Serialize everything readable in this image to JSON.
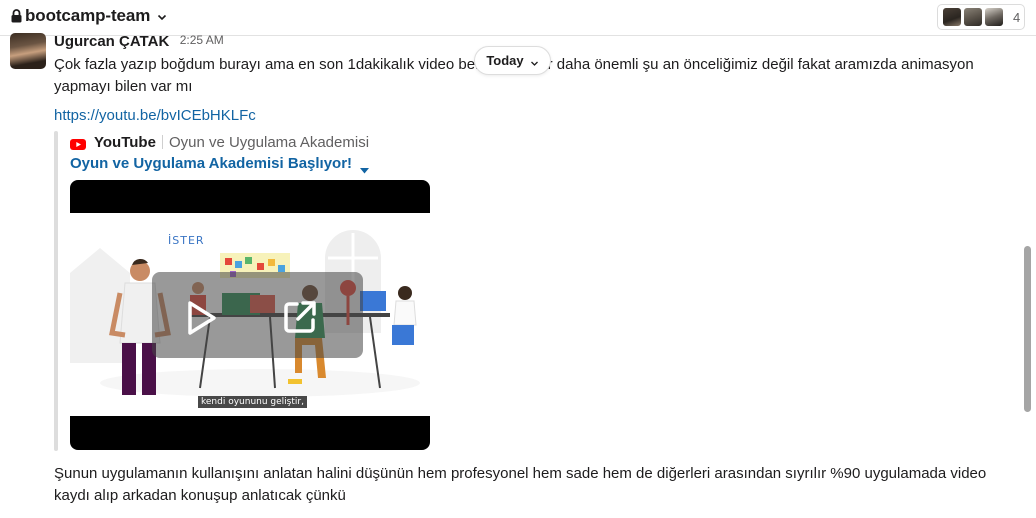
{
  "header": {
    "channel_name": "bootcamp-team",
    "member_count": "4"
  },
  "message": {
    "sender": "Ugurcan ÇATAK",
    "timestamp": "2:25 AM",
    "text": "Çok fazla yazıp boğdum burayı ama en son 1dakikalık video bendeki kadar daha önemli şu an önceliğimiz değil fakat aramızda animasyon yapmayı bilen var mı",
    "link": "https://youtu.be/bvICEbHKLFc"
  },
  "date_divider": {
    "label": "Today"
  },
  "attachment": {
    "provider": "YouTube",
    "channel": "Oyun ve Uygulama Akademisi",
    "title": "Oyun ve Uygulama Akademisi Başlıyor!",
    "thumbnail_sign": "İSTER",
    "thumbnail_caption": "kendi oyununu geliştir,"
  },
  "message2": {
    "text": "Şunun uygulamanın kullanışını anlatan halini düşünün hem profesyonel hem sade hem de diğerleri arasından sıyrılır %90 uygulamada video kaydı alıp arkadan konuşup anlatıcak çünkü"
  },
  "colors": {
    "link": "#1264a3",
    "youtube_red": "#ff0000",
    "text": "#1d1c1d",
    "muted": "#616061"
  }
}
